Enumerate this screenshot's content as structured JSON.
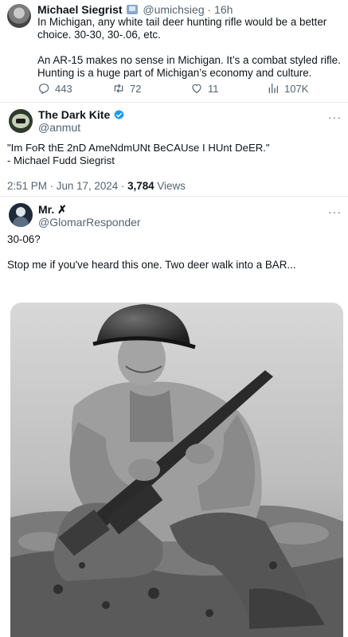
{
  "quoted_tweet": {
    "display_name": "Michael Siegrist",
    "handle": "@umichsieg",
    "separator": "·",
    "time": "16h",
    "paragraphs": [
      "In Michigan, any white tail deer hunting rifle would be a better choice. 30-30, 30-.06, etc.",
      "An AR-15 makes no sense in Michigan. It’s a combat styled rifle. Hunting is a huge part of Michigan’s economy and culture."
    ],
    "actions": {
      "replies": "443",
      "reposts": "72",
      "likes": "11",
      "views": "107K"
    }
  },
  "main_tweet": {
    "display_name": "The Dark Kite",
    "handle": "@anmut",
    "more": "···",
    "text_line1": "\"Im FoR thE 2nD AmeNdmUNt BeCAUse I HUnt DeER.\"",
    "text_line2": "- Michael Fudd Siegrist",
    "timestamp": "2:51 PM · Jun 17, 2024 · ",
    "views_count": "3,784",
    "views_label": " Views"
  },
  "reply": {
    "display_name": "Mr. ✗",
    "handle": "@GlomarResponder",
    "more": "···",
    "paragraphs": [
      "30-06?",
      "Stop me if you've heard this one. Two deer walk into a BAR..."
    ]
  },
  "colors": {
    "text": "#0f1419",
    "muted": "#536471",
    "verified": "#1d9bf0",
    "divider": "#e6e9eb"
  },
  "icons": [
    "reply-icon",
    "repost-icon",
    "like-icon",
    "views-icon",
    "verified-badge-icon",
    "more-icon"
  ]
}
